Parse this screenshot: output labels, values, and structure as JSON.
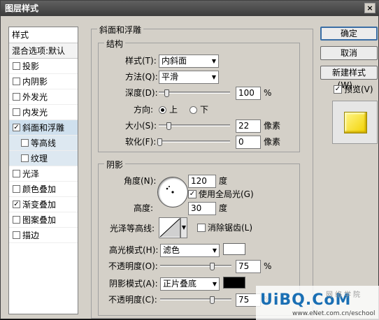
{
  "window": {
    "title": "图层样式",
    "close": "×"
  },
  "style_list": {
    "header": "样式",
    "blend_options": "混合选项:默认",
    "items": [
      {
        "label": "投影",
        "checked": false
      },
      {
        "label": "内阴影",
        "checked": false
      },
      {
        "label": "外发光",
        "checked": false
      },
      {
        "label": "内发光",
        "checked": false
      },
      {
        "label": "斜面和浮雕",
        "checked": true
      },
      {
        "label": "等高线",
        "checked": false
      },
      {
        "label": "纹理",
        "checked": false
      },
      {
        "label": "光泽",
        "checked": false
      },
      {
        "label": "颜色叠加",
        "checked": false
      },
      {
        "label": "渐变叠加",
        "checked": true
      },
      {
        "label": "图案叠加",
        "checked": false
      },
      {
        "label": "描边",
        "checked": false
      }
    ],
    "check_mark": "✓"
  },
  "bevel": {
    "group_title": "斜面和浮雕",
    "structure": {
      "title": "结构",
      "style_label": "样式(T):",
      "style_value": "内斜面",
      "technique_label": "方法(Q):",
      "technique_value": "平滑",
      "depth_label": "深度(D):",
      "depth_value": "100",
      "depth_unit": "%",
      "depth_level": 0.1,
      "direction_label": "方向:",
      "direction_up": "上",
      "direction_down": "下",
      "size_label": "大小(S):",
      "size_value": "22",
      "size_unit": "像素",
      "soften_label": "软化(F):",
      "soften_value": "0",
      "soften_unit": "像素"
    },
    "shading": {
      "title": "阴影",
      "angle_label": "角度(N):",
      "angle_value": "120",
      "angle_unit": "度",
      "global_light_label": "使用全局光(G)",
      "altitude_label": "高度:",
      "altitude_value": "30",
      "altitude_unit": "度",
      "gloss_contour_label": "光泽等高线:",
      "anti_alias_label": "消除锯齿(L)",
      "highlight_mode_label": "高光模式(H):",
      "highlight_mode_value": "滤色",
      "highlight_color": "#ffffff",
      "highlight_opacity_label": "不透明度(O):",
      "highlight_opacity_value": "75",
      "shadow_mode_label": "阴影模式(A):",
      "shadow_mode_value": "正片叠底",
      "shadow_color": "#000000",
      "shadow_opacity_label": "不透明度(C):",
      "shadow_opacity_value": "75",
      "percent": "%"
    }
  },
  "buttons": {
    "ok": "确定",
    "cancel": "取消",
    "new_style": "新建样式(W)...",
    "preview_label": "预览(V)"
  },
  "watermark": {
    "main": "UiBQ.CoM",
    "side": "网络学院",
    "url": "www.eNet.com.cn/eschool"
  }
}
